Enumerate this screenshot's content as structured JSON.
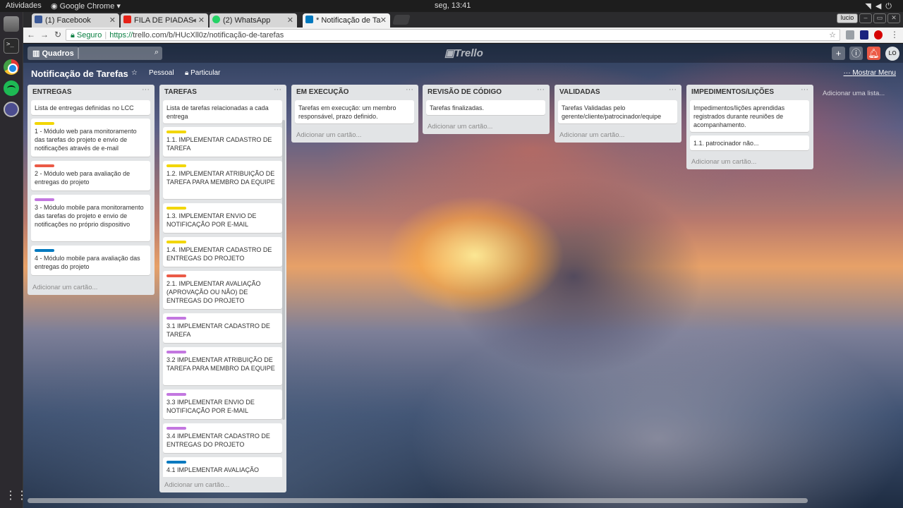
{
  "system": {
    "activities": "Atividades",
    "app_menu": "Google Chrome",
    "clock": "seg, 13:41"
  },
  "browser": {
    "tabs": [
      {
        "title": "(1) Facebook"
      },
      {
        "title": "FILA DE PIADAS"
      },
      {
        "title": "(2) WhatsApp"
      },
      {
        "title": "* Notificação de Ta"
      }
    ],
    "user_button": "lucio",
    "url_secure_label": "Seguro",
    "url_scheme": "https://",
    "url_host": "trello.com",
    "url_path": "/b/HUcXll0z/notificação-de-tarefas"
  },
  "trello": {
    "boards_button": "Quadros",
    "logo": "Trello",
    "avatar_initials": "LO",
    "board_title": "Notificação de Tarefas",
    "board_team": "Pessoal",
    "board_visibility": "Particular",
    "show_menu": "Mostrar Menu",
    "add_list": "Adicionar uma lista...",
    "add_card": "Adicionar um cartão...",
    "label_colors": {
      "yellow": "#f2d600",
      "red": "#eb5a46",
      "purple": "#c377e0",
      "blue": "#0079bf"
    },
    "lists": [
      {
        "name": "ENTREGAS",
        "cards": [
          {
            "text": "Lista de entregas definidas no LCC",
            "label": null
          },
          {
            "text": "1 - Módulo web para monitoramento das tarefas do projeto e envio de notificações através de e-mail",
            "label": "yellow"
          },
          {
            "text": "2 - Módulo web para avaliação de entregas do projeto",
            "label": "red"
          },
          {
            "text": "3 - Módulo mobile para monitoramento das tarefas do projeto e envio de notificações no próprio dispositivo",
            "label": "purple"
          },
          {
            "text": "4 - Módulo mobile para avaliação das entregas do projeto",
            "label": "blue"
          }
        ]
      },
      {
        "name": "TAREFAS",
        "cards": [
          {
            "text": "Lista de tarefas relacionadas a cada entrega",
            "label": null
          },
          {
            "text": "1.1. IMPLEMENTAR CADASTRO DE TAREFA",
            "label": "yellow"
          },
          {
            "text": "1.2. IMPLEMENTAR ATRIBUIÇÃO DE TAREFA PARA MEMBRO DA EQUIPE",
            "label": "yellow"
          },
          {
            "text": "1.3. IMPLEMENTAR ENVIO DE NOTIFICAÇÃO POR E-MAIL",
            "label": "yellow"
          },
          {
            "text": "1.4. IMPLEMENTAR CADASTRO DE ENTREGAS DO PROJETO",
            "label": "yellow"
          },
          {
            "text": "2.1. IMPLEMENTAR AVALIAÇÃO (APROVAÇÃO OU NÃO) DE ENTREGAS DO PROJETO",
            "label": "red"
          },
          {
            "text": "3.1 IMPLEMENTAR CADASTRO DE TAREFA",
            "label": "purple"
          },
          {
            "text": "3.2 IMPLEMENTAR ATRIBUIÇÃO DE TAREFA PARA MEMBRO DA EQUIPE",
            "label": "purple"
          },
          {
            "text": "3.3 IMPLEMENTAR ENVIO DE NOTIFICAÇÃO POR E-MAIL",
            "label": "purple"
          },
          {
            "text": "3.4 IMPLEMENTAR CADASTRO DE ENTREGAS DO PROJETO",
            "label": "purple"
          },
          {
            "text": "4.1 IMPLEMENTAR AVALIAÇÃO",
            "label": "blue"
          }
        ]
      },
      {
        "name": "EM EXECUÇÃO",
        "cards": [
          {
            "text": "Tarefas em execução: um membro responsável, prazo definido.",
            "label": null
          }
        ]
      },
      {
        "name": "REVISÃO DE CÓDIGO",
        "cards": [
          {
            "text": "Tarefas finalizadas.",
            "label": null
          }
        ]
      },
      {
        "name": "VALIDADAS",
        "cards": [
          {
            "text": "Tarefas Validadas pelo gerente/cliente/patrocinador/equipe",
            "label": null
          }
        ]
      },
      {
        "name": "IMPEDIMENTOS/LIÇÕES",
        "cards": [
          {
            "text": "Impedimentos/lições aprendidas registrados durante reuniões de acompanhamento.",
            "label": null
          },
          {
            "text": "1.1. patrocinador não...",
            "label": null
          }
        ]
      }
    ]
  }
}
